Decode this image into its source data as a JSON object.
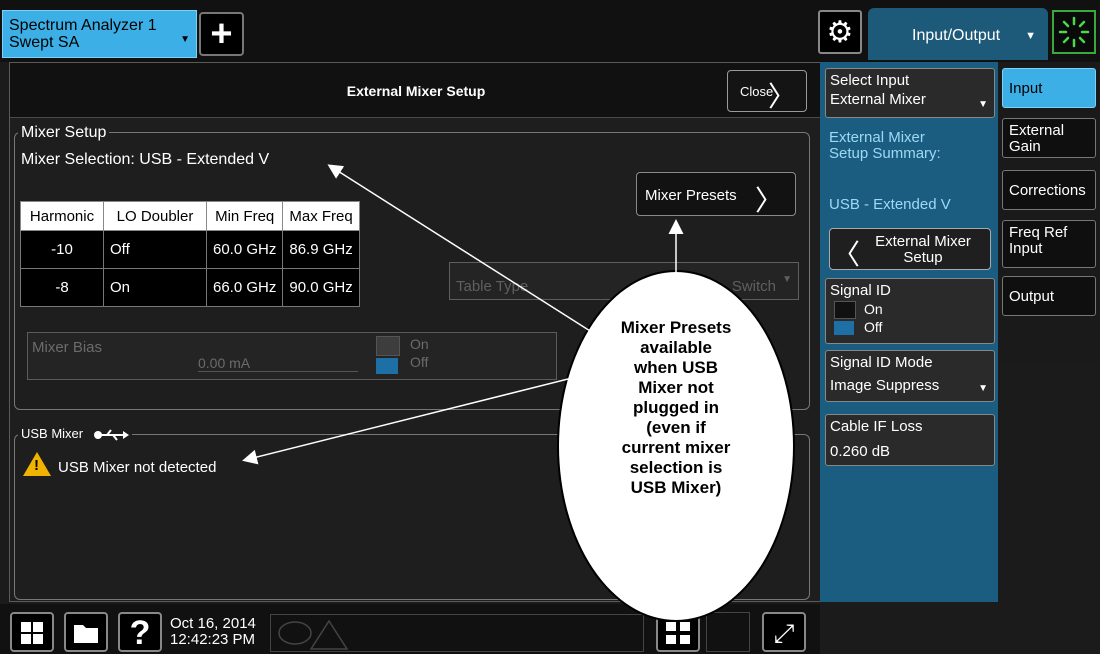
{
  "top": {
    "instrument_tab_line1": "Spectrum Analyzer 1",
    "instrument_tab_line2": "Swept SA",
    "add_button": "+",
    "menu_title": "Input/Output"
  },
  "dialog": {
    "title": "External Mixer Setup",
    "close_label": "Close",
    "mixer_setup_legend": "Mixer Setup",
    "mixer_selection_label": "Mixer Selection:",
    "mixer_selection_value": "USB - Extended V",
    "presets_label": "Mixer Presets",
    "table_type_label": "Table Type",
    "table_type_value": "Switch",
    "table": {
      "headers": [
        "Harmonic",
        "LO Doubler",
        "Min Freq",
        "Max Freq"
      ],
      "rows": [
        [
          "-10",
          "Off",
          "60.0 GHz",
          "86.9 GHz"
        ],
        [
          "-8",
          "On",
          "66.0 GHz",
          "90.0 GHz"
        ]
      ]
    },
    "mixer_bias_label": "Mixer Bias",
    "mixer_bias_value": "0.00 mA",
    "bias_on": "On",
    "bias_off": "Off",
    "usb_legend": "USB Mixer",
    "usb_status": "USB Mixer not detected"
  },
  "callout": {
    "text": "Mixer Presets\navailable\nwhen USB\nMixer not\nplugged in\n(even if\ncurrent mixer\nselection is\nUSB Mixer)"
  },
  "taskbar": {
    "date": "Oct 16, 2014",
    "time": "12:42:23 PM",
    "help": "?"
  },
  "menu_panel": {
    "select_input_label": "Select Input",
    "select_input_value": "External Mixer",
    "summary_label_line1": "External Mixer",
    "summary_label_line2": "Setup Summary:",
    "summary_value": "USB - Extended V",
    "ext_mixer_btn_line1": "External Mixer",
    "ext_mixer_btn_line2": "Setup",
    "signal_id_label": "Signal ID",
    "signal_id_on": "On",
    "signal_id_off": "Off",
    "signal_id_mode_label": "Signal ID Mode",
    "signal_id_mode_value": "Image Suppress",
    "cable_if_loss_label": "Cable IF Loss",
    "cable_if_loss_value": "0.260 dB"
  },
  "softkeys": {
    "input": "Input",
    "external_gain_1": "External",
    "external_gain_2": "Gain",
    "corrections": "Corrections",
    "freq_ref_1": "Freq Ref",
    "freq_ref_2": "Input",
    "output": "Output"
  },
  "colors": {
    "accent_blue": "#3cb0e6",
    "panel_blue": "#1a5d80",
    "warning": "#f0b400"
  }
}
